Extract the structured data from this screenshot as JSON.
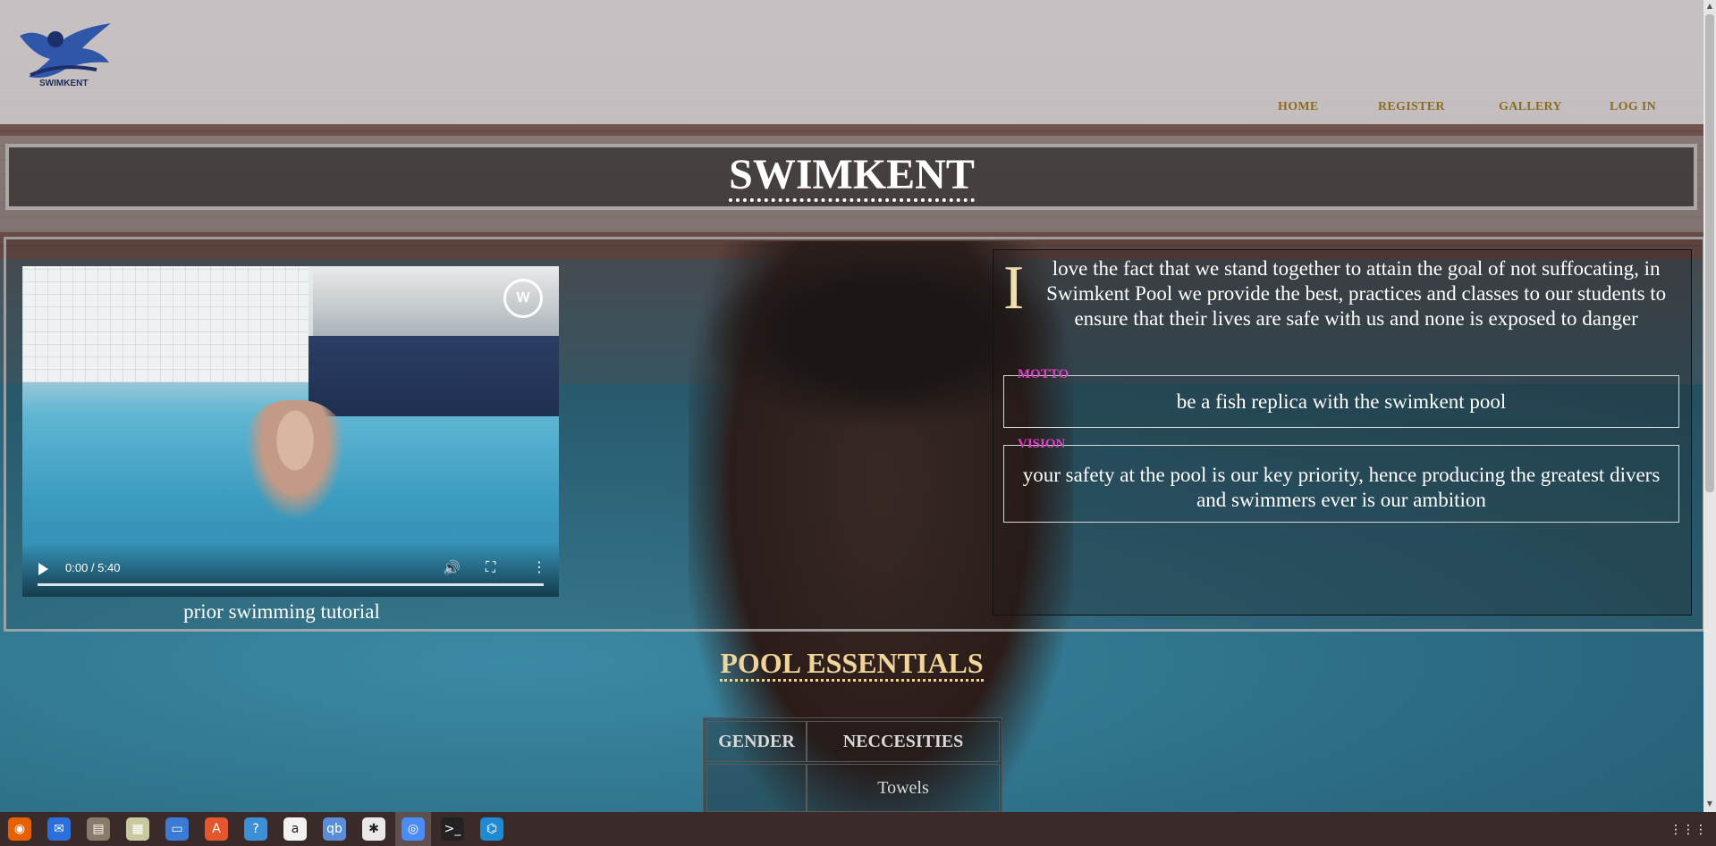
{
  "brand": {
    "logo_text": "SWIMKENT"
  },
  "nav": {
    "items": [
      "HOME",
      "REGISTER",
      "GALLERY",
      "LOG IN"
    ]
  },
  "title": "SWIMKENT",
  "video": {
    "time": "0:00 / 5:40",
    "caption": "prior swimming tutorial",
    "progress": 0
  },
  "intro": {
    "dropcap": "I",
    "text": "love the fact that we stand together to attain the goal of not suffocating, in Swimkent Pool we provide the best, practices and classes to our students to ensure that their lives are safe with us and none is exposed to danger"
  },
  "motto": {
    "legend": "MOTTO",
    "text": "be a fish replica with the swimkent pool"
  },
  "vision": {
    "legend": "VISION",
    "text": "your safety at the pool is our key priority, hence producing the greatest divers and swimmers ever is our ambition"
  },
  "essentials": {
    "title": "POOL ESSENTIALS",
    "headers": [
      "GENDER",
      "NECCESITIES"
    ],
    "rows": [
      [
        "",
        "Towels"
      ]
    ]
  },
  "taskbar": {
    "apps": [
      "firefox-icon",
      "thunderbird-icon",
      "files-icon",
      "archive-icon",
      "document-icon",
      "software-center-icon",
      "help-icon",
      "amazon-icon",
      "qbittorrent-icon",
      "slack-icon",
      "chrome-icon",
      "terminal-icon",
      "vscode-icon"
    ],
    "glyphs": [
      "◉",
      "✉",
      "▤",
      "▦",
      "▭",
      "A",
      "?",
      "a",
      "qb",
      "✱",
      "◎",
      ">_",
      "⌬"
    ]
  },
  "colors": {
    "nav_text": "#8a6d1e",
    "legend": "#e040c8",
    "essentials_title": "#f0d59a",
    "taskbar": "#3b2a2a"
  }
}
